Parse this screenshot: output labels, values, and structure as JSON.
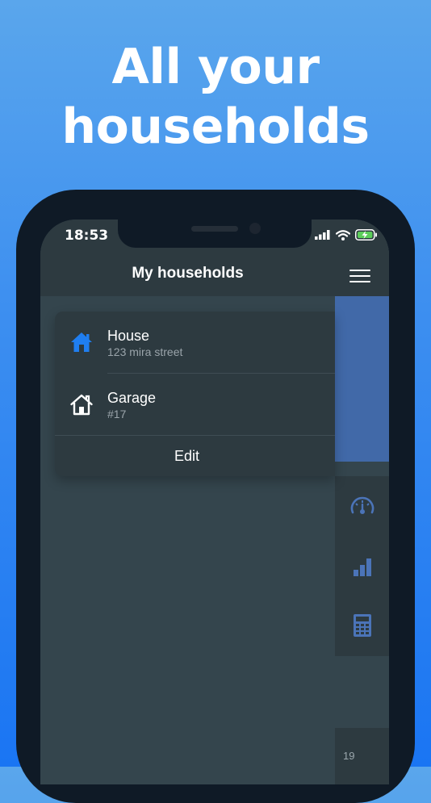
{
  "headline": {
    "line1": "All your",
    "line2": "households"
  },
  "status_bar": {
    "time": "18:53",
    "icons": [
      "signal-icon",
      "wifi-icon",
      "battery-charging-icon"
    ]
  },
  "header": {
    "title": "My households"
  },
  "households": [
    {
      "name": "House",
      "address": "123 mira street",
      "icon": "house-filled-icon",
      "icon_color": "#1f7ef0"
    },
    {
      "name": "Garage",
      "address": "#17",
      "icon": "house-outline-icon",
      "icon_color": "#ffffff"
    }
  ],
  "card": {
    "edit_label": "Edit"
  },
  "side_panel": {
    "tools": [
      "speedometer-icon",
      "bar-chart-icon",
      "calculator-icon"
    ],
    "footer_number": "19",
    "accent_color": "#4169a8"
  }
}
